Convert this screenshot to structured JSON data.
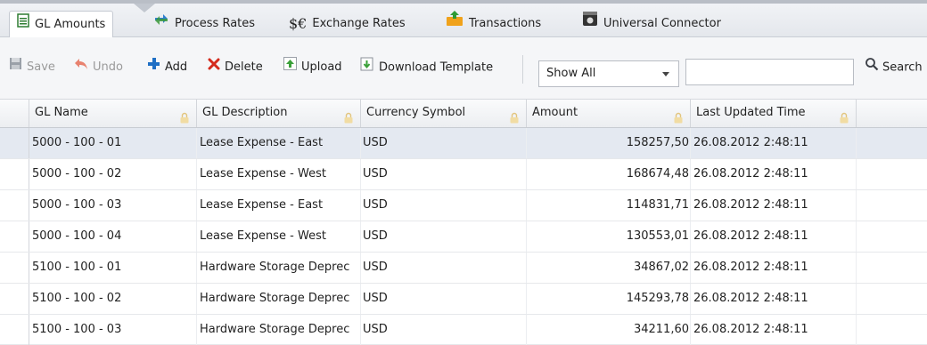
{
  "tabs": [
    {
      "label": "GL Amounts",
      "icon": "list-icon",
      "active": true
    },
    {
      "label": "Process Rates",
      "icon": "process-arrows-icon"
    },
    {
      "label": "Exchange Rates",
      "icon": "currency-icon",
      "glyph": "$€"
    },
    {
      "label": "Transactions",
      "icon": "transactions-icon"
    },
    {
      "label": "Universal Connector",
      "icon": "connector-icon"
    }
  ],
  "toolbar": {
    "save_label": "Save",
    "undo_label": "Undo",
    "add_label": "Add",
    "delete_label": "Delete",
    "upload_label": "Upload",
    "download_label": "Download Template",
    "filter_value": "Show All",
    "search_value": "",
    "search_label": "Search"
  },
  "grid": {
    "columns": [
      "GL Name",
      "GL Description",
      "Currency Symbol",
      "Amount",
      "Last Updated Time"
    ],
    "rows": [
      {
        "gl_name": "5000 - 100 - 01",
        "description": "Lease Expense - East",
        "currency": "USD",
        "amount": "158257,50",
        "updated": "26.08.2012 2:48:11"
      },
      {
        "gl_name": "5000 - 100 - 02",
        "description": "Lease Expense - West",
        "currency": "USD",
        "amount": "168674,48",
        "updated": "26.08.2012 2:48:11"
      },
      {
        "gl_name": "5000 - 100 - 03",
        "description": "Lease Expense - East",
        "currency": "USD",
        "amount": "114831,71",
        "updated": "26.08.2012 2:48:11"
      },
      {
        "gl_name": "5000 - 100 - 04",
        "description": "Lease Expense - West",
        "currency": "USD",
        "amount": "130553,01",
        "updated": "26.08.2012 2:48:11"
      },
      {
        "gl_name": "5100 - 100 - 01",
        "description": "Hardware Storage Deprec",
        "currency": "USD",
        "amount": "34867,02",
        "updated": "26.08.2012 2:48:11"
      },
      {
        "gl_name": "5100 - 100 - 02",
        "description": "Hardware Storage Deprec",
        "currency": "USD",
        "amount": "145293,78",
        "updated": "26.08.2012 2:48:11"
      },
      {
        "gl_name": "5100 - 100 - 03",
        "description": "Hardware Storage Deprec",
        "currency": "USD",
        "amount": "34211,60",
        "updated": "26.08.2012 2:48:11"
      }
    ]
  },
  "colors": {
    "selected_row": "#e4e9f1",
    "delete_red": "#d42a1c",
    "add_blue": "#1f6fc5",
    "upload_green": "#3aa039"
  }
}
